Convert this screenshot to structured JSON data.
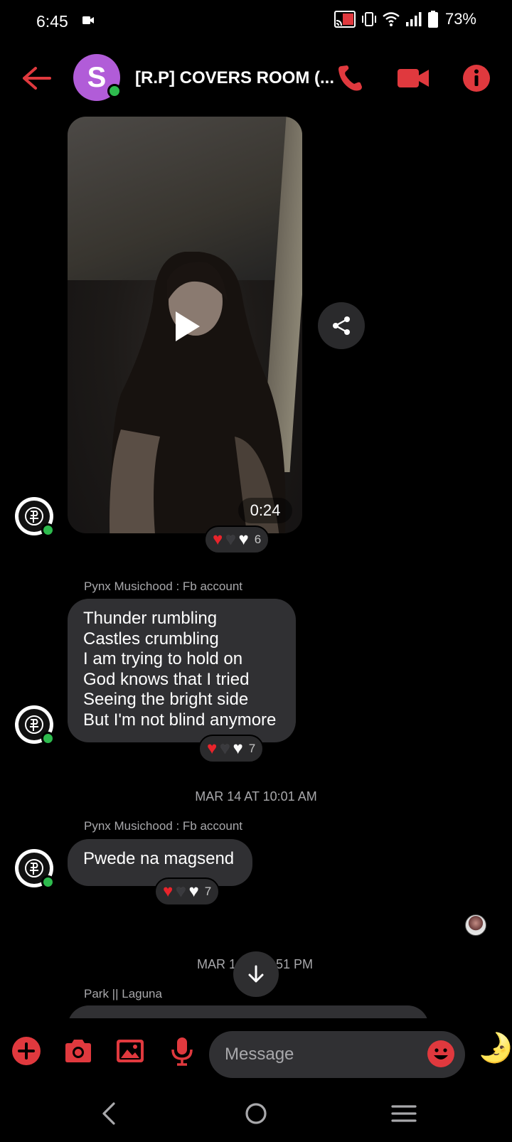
{
  "status": {
    "time": "6:45",
    "battery": "73%"
  },
  "header": {
    "avatar_letter": "S",
    "title": "[R.P] COVERS ROOM (...",
    "accent": "#e0393e"
  },
  "video": {
    "duration": "0:24",
    "reaction_count": "6"
  },
  "messages": [
    {
      "sender": "Pynx Musichood : Fb account",
      "lines": [
        "Thunder rumbling",
        "Castles crumbling",
        "I am trying to hold on",
        "God knows that I tried",
        "Seeing the bright side",
        "But I'm not blind anymore"
      ],
      "reaction_count": "7"
    },
    {
      "sender": "Pynx Musichood : Fb account",
      "text": "Pwede na magsend",
      "reaction_count": "7"
    }
  ],
  "timestamps": {
    "first": "MAR 14 AT 10:01 AM",
    "second_left": "MAR 1",
    "second_right": "51 PM"
  },
  "next_sender": "Park || Laguna",
  "composer": {
    "placeholder": "Message"
  }
}
